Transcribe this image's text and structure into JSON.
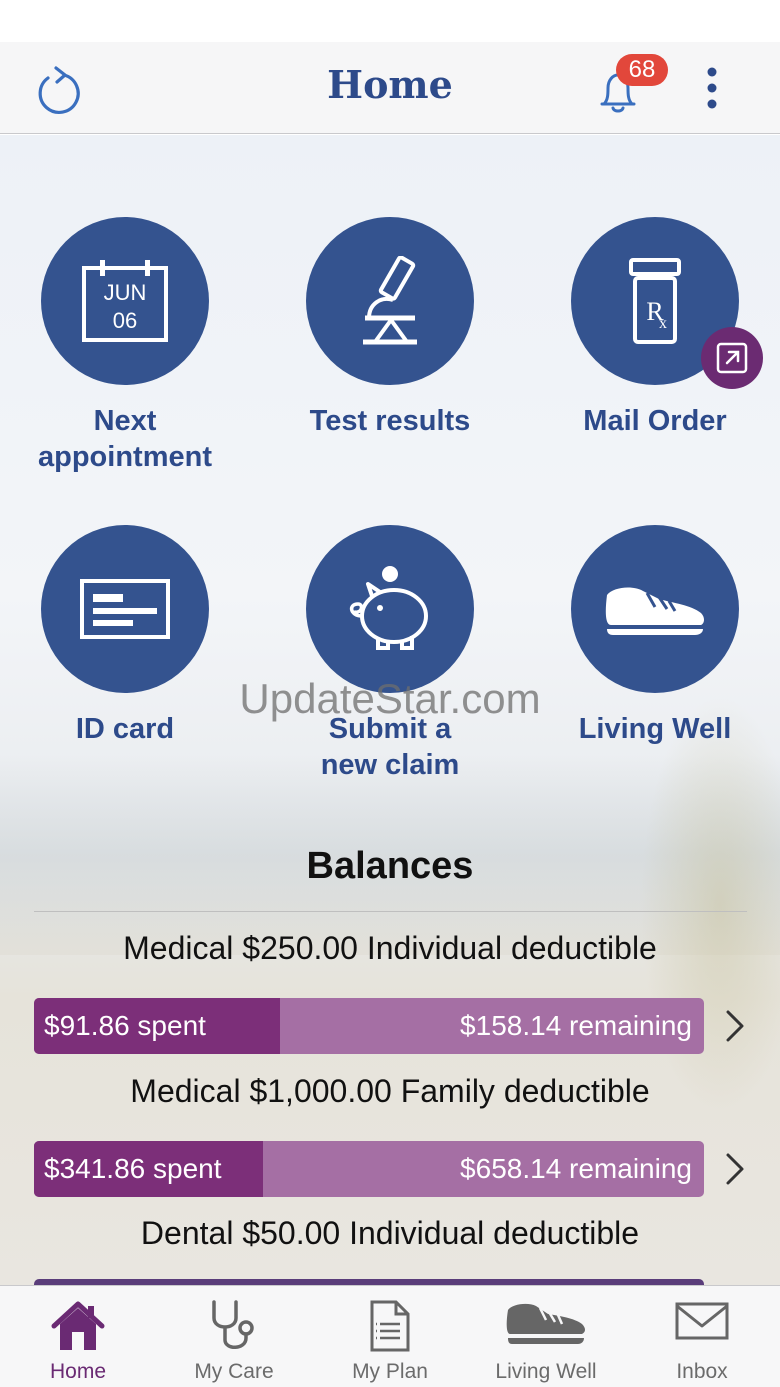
{
  "header": {
    "title": "Home",
    "notification_count": "68",
    "icons": [
      "refresh-icon",
      "bell-icon",
      "more-vertical-icon"
    ]
  },
  "tiles": [
    {
      "label": "Next\nappointment",
      "icon": "calendar-icon",
      "calendar_month": "JUN",
      "calendar_day": "06"
    },
    {
      "label": "Test results",
      "icon": "microscope-icon"
    },
    {
      "label": "Mail Order",
      "icon": "prescription-bottle-icon",
      "external": true
    },
    {
      "label": "ID card",
      "icon": "id-card-icon"
    },
    {
      "label": "Submit a\nnew claim",
      "icon": "piggy-bank-icon"
    },
    {
      "label": "Living Well",
      "icon": "sneaker-icon"
    }
  ],
  "watermark": "UpdateStar.com",
  "balances": {
    "title": "Balances",
    "items": [
      {
        "title": "Medical $250.00 Individual deductible",
        "spent": "$91.86 spent",
        "remaining": "$158.14 remaining",
        "fraction_spent": 0.367
      },
      {
        "title": "Medical $1,000.00 Family deductible",
        "spent": "$341.86 spent",
        "remaining": "$658.14 remaining",
        "fraction_spent": 0.342
      },
      {
        "title": "Dental $50.00 Individual deductible"
      }
    ]
  },
  "tabbar": [
    {
      "label": "Home",
      "icon": "home-icon",
      "active": true
    },
    {
      "label": "My Care",
      "icon": "stethoscope-icon"
    },
    {
      "label": "My Plan",
      "icon": "document-icon"
    },
    {
      "label": "Living Well",
      "icon": "sneaker-icon"
    },
    {
      "label": "Inbox",
      "icon": "envelope-icon"
    }
  ],
  "colors": {
    "primary_blue": "#34538f",
    "label_blue": "#2d4a8a",
    "spent_purple": "#7c2f79",
    "remaining_purple": "#a56fa4",
    "badge_red": "#e2473b",
    "active_tab": "#6a2a73"
  }
}
